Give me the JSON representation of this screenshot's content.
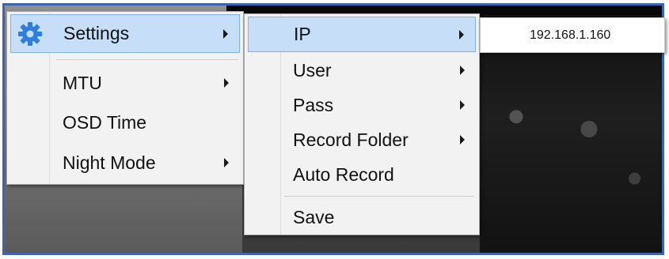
{
  "main_menu": {
    "items": [
      {
        "label": "Settings",
        "has_submenu": true,
        "highlighted": true,
        "icon": "gear-icon"
      },
      {
        "label": "MTU",
        "has_submenu": true
      },
      {
        "label": "OSD Time",
        "has_submenu": false
      },
      {
        "label": "Night Mode",
        "has_submenu": true
      }
    ]
  },
  "settings_submenu": {
    "items": [
      {
        "label": "IP",
        "has_submenu": true,
        "highlighted": true
      },
      {
        "label": "User",
        "has_submenu": true
      },
      {
        "label": "Pass",
        "has_submenu": true
      },
      {
        "label": "Record Folder",
        "has_submenu": true
      },
      {
        "label": "Auto Record",
        "has_submenu": false
      },
      {
        "label": "Save",
        "has_submenu": false
      }
    ]
  },
  "ip_submenu": {
    "value": "192.168.1.160"
  },
  "colors": {
    "highlight_fill": "#c6def7",
    "highlight_border": "#7fb2e8",
    "frame_border": "#3b66ad",
    "gear_icon": "#2f7fe0"
  }
}
